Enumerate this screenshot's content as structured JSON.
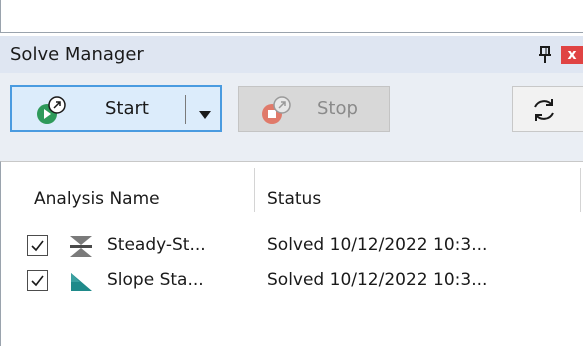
{
  "panel": {
    "title": "Solve Manager",
    "close_glyph": "x",
    "pin_icon": "pin-icon"
  },
  "toolbar": {
    "start_label": "Start",
    "stop_label": "Stop",
    "start_icon": "run-analysis-icon",
    "stop_icon": "stop-analysis-icon",
    "refresh_icon": "refresh-icon",
    "start_color": "#2e9a5a",
    "stop_color": "#e07a6a"
  },
  "list": {
    "columns": [
      "Analysis Name",
      "Status"
    ],
    "rows": [
      {
        "checked": true,
        "icon": "seepage-analysis-icon",
        "name": "Steady-St...",
        "status": "Solved 10/12/2022 10:3..."
      },
      {
        "checked": true,
        "icon": "slope-stability-icon",
        "name": "Slope Sta...",
        "status": "Solved 10/12/2022 10:3..."
      }
    ]
  },
  "colors": {
    "title_bg": "#dfe6f2",
    "toolbar_bg": "#eaeef4",
    "start_highlight": "#dcecfb",
    "start_border": "#4a9be0",
    "close_red": "#e04343"
  }
}
